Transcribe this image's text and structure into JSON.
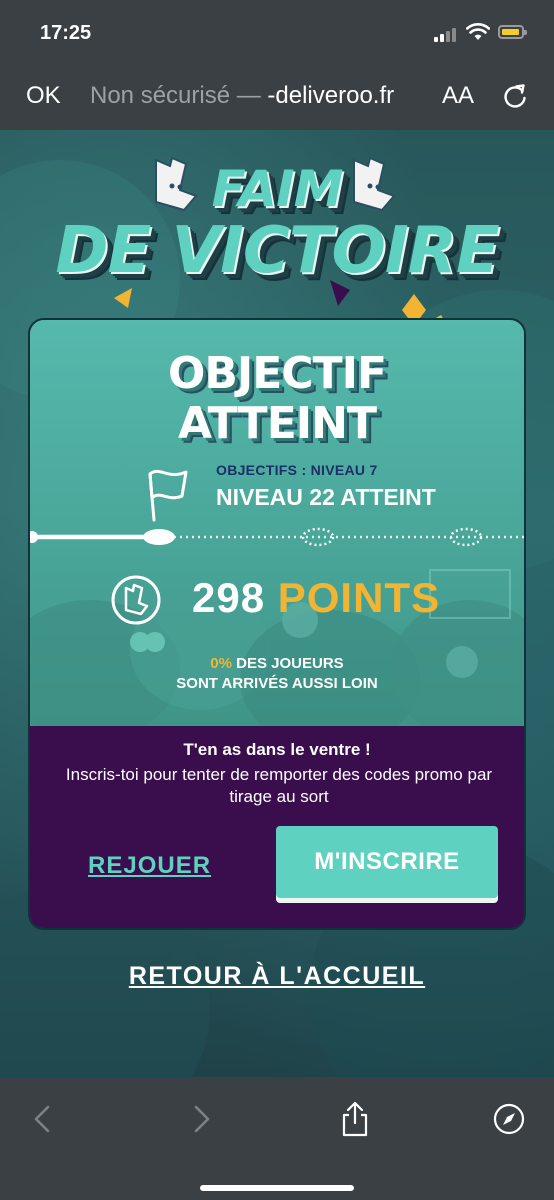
{
  "status_bar": {
    "time": "17:25"
  },
  "browser": {
    "done_label": "OK",
    "insecure_label": "Non sécurisé —",
    "domain": "-deliveroo.fr",
    "text_size_label": "AA"
  },
  "game": {
    "logo_line1": "FAIM",
    "logo_line2": "DE VICTOIRE",
    "result_title_line1": "OBJECTIF",
    "result_title_line2": "ATTEINT",
    "objective_label": "OBJECTIFS : NIVEAU 7",
    "objective_level": "NIVEAU 22 ATTEINT",
    "progress_fraction": 0.26,
    "points_value": "298",
    "points_unit": "POINTS",
    "players_percent": "0%",
    "players_line1_rest": " DES JOUEURS",
    "players_line2": "SONT ARRIVÉS AUSSI LOIN",
    "promo_title": "T'en as dans le ventre !",
    "promo_text": "Inscris-toi pour tenter de remporter des codes promo par tirage au sort",
    "replay_label": "REJOUER",
    "signup_label": "M'INSCRIRE",
    "home_label": "RETOUR À L'ACCUEIL"
  },
  "colors": {
    "teal": "#5fd1c0",
    "purple": "#3a0d4c",
    "gold": "#f2b533",
    "navy": "#1e2e66"
  },
  "toolbar": {
    "icons": [
      "back-icon",
      "forward-icon",
      "share-icon",
      "compass-icon"
    ]
  }
}
